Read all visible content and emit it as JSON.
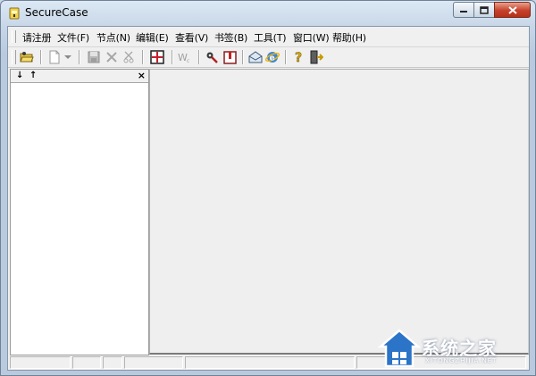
{
  "window": {
    "title": "SecureCase"
  },
  "menubar": {
    "items": [
      "请注册",
      "文件(F)",
      "节点(N)",
      "编辑(E)",
      "查看(V)",
      "书签(B)",
      "工具(T)",
      "窗口(W)",
      "帮助(H)"
    ]
  },
  "toolbar": {
    "buttons": [
      "open-folder",
      "new-document",
      "dropdown",
      "save",
      "delete",
      "cut",
      "insert-table",
      "word-count",
      "tools-gear",
      "bookmark",
      "email",
      "internet-explorer",
      "help",
      "exit"
    ]
  },
  "left_pane": {
    "arrow_down": "↓",
    "arrow_up": "↑",
    "close": "×"
  },
  "watermark": {
    "text": "系统之家",
    "sub": "XITONGZHIJIA.NET"
  },
  "colors": {
    "titlebar": "#c7d6e7",
    "close_button": "#c7412a",
    "client_bg": "#f0f0f0"
  }
}
